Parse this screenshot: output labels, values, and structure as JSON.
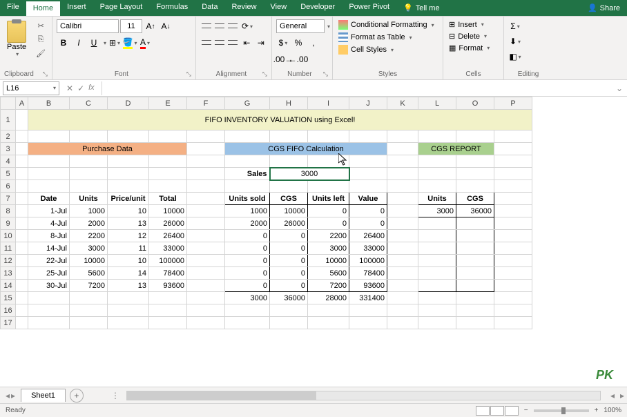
{
  "tabs": {
    "file": "File",
    "home": "Home",
    "insert": "Insert",
    "pagelayout": "Page Layout",
    "formulas": "Formulas",
    "data": "Data",
    "review": "Review",
    "view": "View",
    "developer": "Developer",
    "powerpivot": "Power Pivot",
    "tellme": "Tell me",
    "share": "Share"
  },
  "ribbon": {
    "clipboard": {
      "label": "Clipboard",
      "paste": "Paste"
    },
    "font": {
      "label": "Font",
      "name": "Calibri",
      "size": "11"
    },
    "alignment": {
      "label": "Alignment"
    },
    "number": {
      "label": "Number",
      "format": "General"
    },
    "styles": {
      "label": "Styles",
      "cond": "Conditional Formatting",
      "table": "Format as Table",
      "cell": "Cell Styles"
    },
    "cells": {
      "label": "Cells",
      "insert": "Insert",
      "delete": "Delete",
      "format": "Format"
    },
    "editing": {
      "label": "Editing"
    }
  },
  "namebox": "L16",
  "sheet": {
    "columns": [
      "A",
      "B",
      "C",
      "D",
      "E",
      "F",
      "G",
      "H",
      "I",
      "J",
      "K",
      "L",
      "O",
      "P"
    ],
    "title": "FIFO INVENTORY VALUATION using Excel!",
    "hdr_purchase": "Purchase Data",
    "hdr_cgs": "CGS FIFO Calculation",
    "hdr_report": "CGS REPORT",
    "sales_label": "Sales",
    "sales_value": "3000",
    "purchase_headers": [
      "Date",
      "Units",
      "Price/unit",
      "Total"
    ],
    "cgs_headers": [
      "Units sold",
      "CGS",
      "Units left",
      "Value"
    ],
    "report_headers": [
      "Units",
      "CGS"
    ],
    "purchase_rows": [
      [
        "1-Jul",
        "1000",
        "10",
        "10000"
      ],
      [
        "4-Jul",
        "2000",
        "13",
        "26000"
      ],
      [
        "8-Jul",
        "2200",
        "12",
        "26400"
      ],
      [
        "14-Jul",
        "3000",
        "11",
        "33000"
      ],
      [
        "22-Jul",
        "10000",
        "10",
        "100000"
      ],
      [
        "25-Jul",
        "5600",
        "14",
        "78400"
      ],
      [
        "30-Jul",
        "7200",
        "13",
        "93600"
      ]
    ],
    "cgs_rows": [
      [
        "1000",
        "10000",
        "0",
        "0"
      ],
      [
        "2000",
        "26000",
        "0",
        "0"
      ],
      [
        "0",
        "0",
        "2200",
        "26400"
      ],
      [
        "0",
        "0",
        "3000",
        "33000"
      ],
      [
        "0",
        "0",
        "10000",
        "100000"
      ],
      [
        "0",
        "0",
        "5600",
        "78400"
      ],
      [
        "0",
        "0",
        "7200",
        "93600"
      ]
    ],
    "cgs_totals": [
      "3000",
      "36000",
      "28000",
      "331400"
    ],
    "report_row": [
      "3000",
      "36000"
    ]
  },
  "sheettab": "Sheet1",
  "status": {
    "ready": "Ready",
    "zoom": "100%"
  },
  "chart_data": {
    "type": "table",
    "title": "FIFO INVENTORY VALUATION using Excel!",
    "sales": 3000,
    "purchase": {
      "columns": [
        "Date",
        "Units",
        "Price/unit",
        "Total"
      ],
      "rows": [
        {
          "Date": "1-Jul",
          "Units": 1000,
          "Price/unit": 10,
          "Total": 10000
        },
        {
          "Date": "4-Jul",
          "Units": 2000,
          "Price/unit": 13,
          "Total": 26000
        },
        {
          "Date": "8-Jul",
          "Units": 2200,
          "Price/unit": 12,
          "Total": 26400
        },
        {
          "Date": "14-Jul",
          "Units": 3000,
          "Price/unit": 11,
          "Total": 33000
        },
        {
          "Date": "22-Jul",
          "Units": 10000,
          "Price/unit": 10,
          "Total": 100000
        },
        {
          "Date": "25-Jul",
          "Units": 5600,
          "Price/unit": 14,
          "Total": 78400
        },
        {
          "Date": "30-Jul",
          "Units": 7200,
          "Price/unit": 13,
          "Total": 93600
        }
      ]
    },
    "cgs_fifo": {
      "columns": [
        "Units sold",
        "CGS",
        "Units left",
        "Value"
      ],
      "rows": [
        {
          "Units sold": 1000,
          "CGS": 10000,
          "Units left": 0,
          "Value": 0
        },
        {
          "Units sold": 2000,
          "CGS": 26000,
          "Units left": 0,
          "Value": 0
        },
        {
          "Units sold": 0,
          "CGS": 0,
          "Units left": 2200,
          "Value": 26400
        },
        {
          "Units sold": 0,
          "CGS": 0,
          "Units left": 3000,
          "Value": 33000
        },
        {
          "Units sold": 0,
          "CGS": 0,
          "Units left": 10000,
          "Value": 100000
        },
        {
          "Units sold": 0,
          "CGS": 0,
          "Units left": 5600,
          "Value": 78400
        },
        {
          "Units sold": 0,
          "CGS": 0,
          "Units left": 7200,
          "Value": 93600
        }
      ],
      "totals": {
        "Units sold": 3000,
        "CGS": 36000,
        "Units left": 28000,
        "Value": 331400
      }
    },
    "report": {
      "Units": 3000,
      "CGS": 36000
    }
  }
}
